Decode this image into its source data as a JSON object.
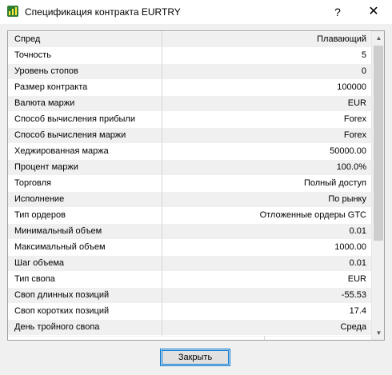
{
  "window": {
    "title": "Спецификация контракта EURTRY",
    "help_symbol": "?",
    "close_symbol": "✕",
    "app_icon": "chart-app-icon"
  },
  "spec": {
    "rows": [
      {
        "label": "Спред",
        "value": "Плавающий"
      },
      {
        "label": "Точность",
        "value": "5"
      },
      {
        "label": "Уровень стопов",
        "value": "0"
      },
      {
        "label": "Размер контракта",
        "value": "100000"
      },
      {
        "label": "Валюта маржи",
        "value": "EUR"
      },
      {
        "label": "Способ вычисления прибыли",
        "value": "Forex"
      },
      {
        "label": "Способ вычисления маржи",
        "value": "Forex"
      },
      {
        "label": "Хеджированная маржа",
        "value": "50000.00"
      },
      {
        "label": "Процент маржи",
        "value": "100.0%"
      },
      {
        "label": "Торговля",
        "value": "Полный доступ"
      },
      {
        "label": "Исполнение",
        "value": "По рынку"
      },
      {
        "label": "Тип ордеров",
        "value": "Отложенные ордеры GTC"
      },
      {
        "label": "Минимальный объем",
        "value": "0.01"
      },
      {
        "label": "Максимальный объем",
        "value": "1000.00"
      },
      {
        "label": "Шаг объема",
        "value": "0.01"
      },
      {
        "label": "Тип свопа",
        "value": "EUR"
      },
      {
        "label": "Своп длинных позиций",
        "value": "-55.53"
      },
      {
        "label": "Своп коротких позиций",
        "value": "17.4"
      },
      {
        "label": "День тройного свопа",
        "value": "Среда"
      }
    ]
  },
  "scrollbar": {
    "up_symbol": "▲",
    "down_symbol": "▼"
  },
  "footer": {
    "close_label": "Закрыть"
  }
}
